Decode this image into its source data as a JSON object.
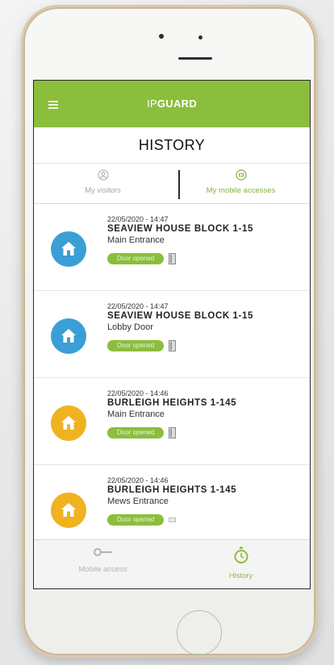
{
  "app": {
    "brand_prefix": "IP",
    "brand_suffix": "GUARD",
    "screen_title": "HISTORY",
    "accent_color": "#8bbe3d"
  },
  "tabs": [
    {
      "label": "My visitors",
      "icon": "visitor-icon",
      "active": false
    },
    {
      "label": "My mobile accesses",
      "icon": "mobile-access-icon",
      "active": true
    }
  ],
  "entries": [
    {
      "datetime": "22/05/2020 - 14:47",
      "site": "SEAVIEW HOUSE BLOCK 1-15",
      "door": "Main Entrance",
      "status": "Door opened",
      "icon": "home-icon",
      "icon_color": "#3a9fd6"
    },
    {
      "datetime": "22/05/2020 - 14:47",
      "site": "SEAVIEW HOUSE BLOCK 1-15",
      "door": "Lobby Door",
      "status": "Door opened",
      "icon": "home-icon",
      "icon_color": "#3a9fd6"
    },
    {
      "datetime": "22/05/2020 - 14:46",
      "site": "BURLEIGH HEIGHTS 1-145",
      "door": "Main Entrance",
      "status": "Door opened",
      "icon": "home-icon",
      "icon_color": "#f0b21f"
    },
    {
      "datetime": "22/05/2020 - 14:46",
      "site": "BURLEIGH HEIGHTS 1-145",
      "door": "Mews Entrance",
      "status": "Door opened",
      "icon": "home-icon",
      "icon_color": "#f0b21f"
    }
  ],
  "navbar": [
    {
      "label": "Mobile access",
      "icon": "key-icon",
      "active": false
    },
    {
      "label": "History",
      "icon": "stopwatch-icon",
      "active": true
    }
  ]
}
